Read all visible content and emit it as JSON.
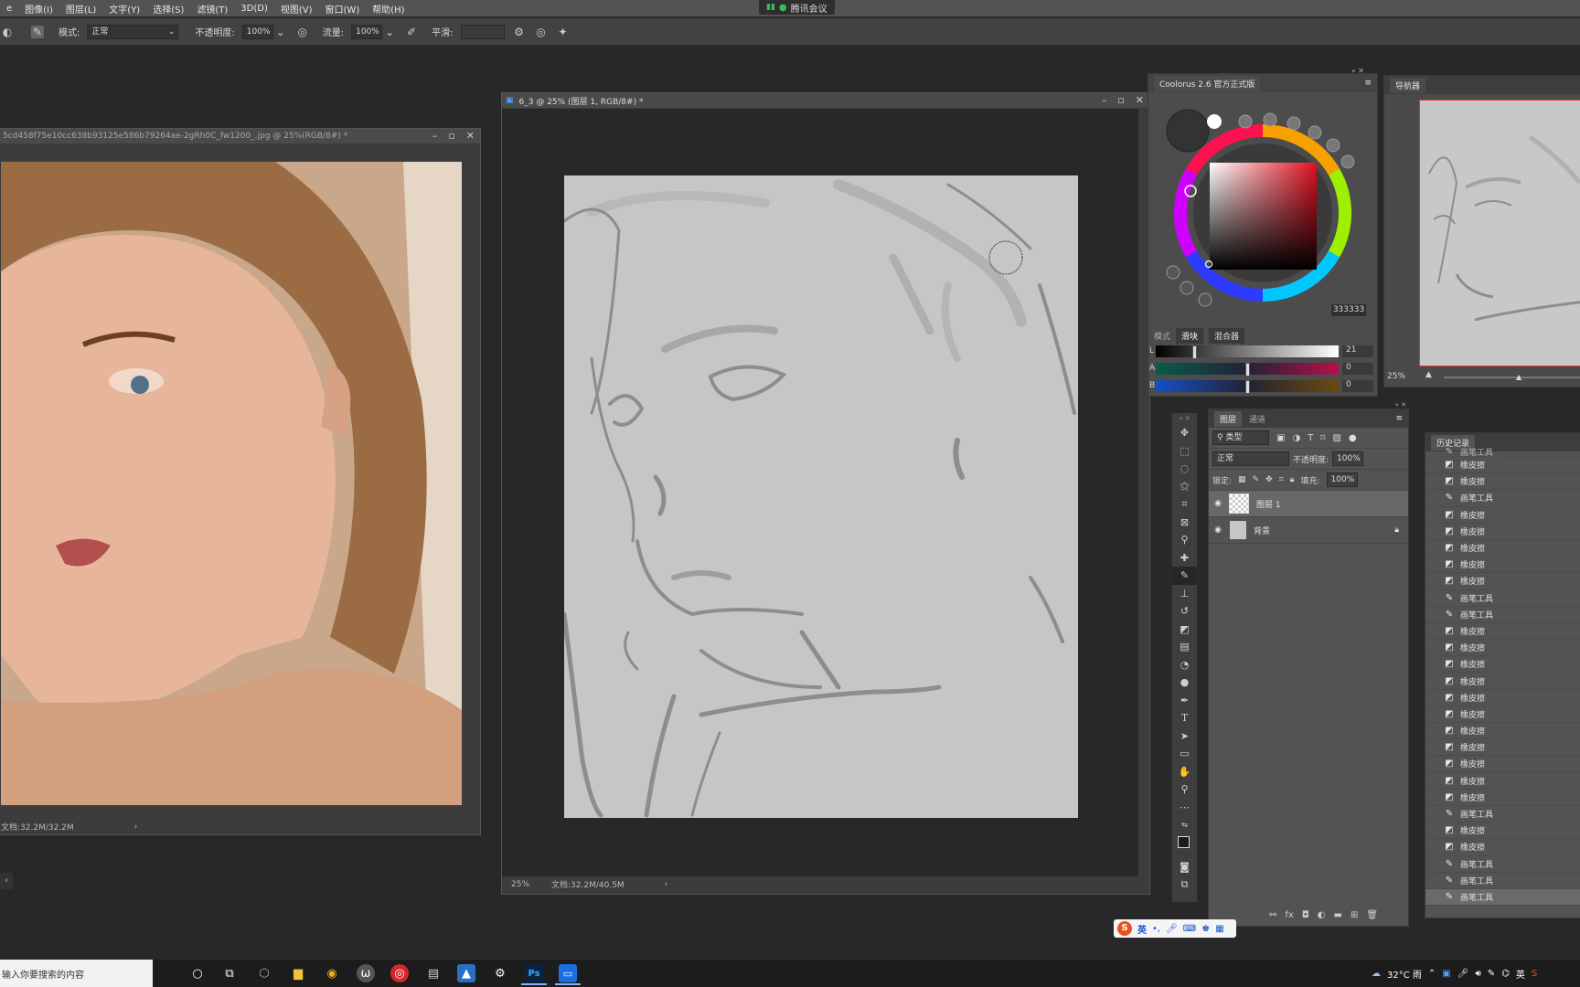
{
  "menubar": {
    "items": [
      "e",
      "图像(I)",
      "图层(L)",
      "文字(Y)",
      "选择(S)",
      "滤镜(T)",
      "3D(D)",
      "视图(V)",
      "窗口(W)",
      "帮助(H)"
    ],
    "meeting": "腾讯会议"
  },
  "options": {
    "mode_label": "模式:",
    "mode_value": "正常",
    "opacity_label": "不透明度:",
    "opacity_value": "100%",
    "flow_label": "流量:",
    "flow_value": "100%",
    "smooth_label": "平滑:"
  },
  "photo_window": {
    "title": "5cd458f75e10cc638b93125e586b79264ae-2gRh0C_fw1200_.jpg @ 25%(RGB/8#) *",
    "status": "文档:32.2M/32.2M"
  },
  "canvas_window": {
    "title": "6_3 @ 25% (图层 1, RGB/8#) *",
    "zoom": "25%",
    "status": "文档:32.2M/40.5M"
  },
  "coolorus": {
    "title": "Coolorus 2.6 官方正式版",
    "hex": "333333",
    "mode_label": "模式",
    "tab_slider": "滑块",
    "tab_mixer": "混合器",
    "L_label": "L",
    "A_label": "A",
    "B_label": "B",
    "L_value": "21",
    "A_value": "0",
    "B_value": "0"
  },
  "navigator": {
    "title": "导航器",
    "zoom": "25%"
  },
  "layers": {
    "tab_layers": "图层",
    "tab_channels": "通道",
    "filter_kind": "类型",
    "blend_mode": "正常",
    "opacity_label": "不透明度:",
    "opacity_value": "100%",
    "lock_label": "锁定:",
    "fill_label": "填充:",
    "fill_value": "100%",
    "rows": [
      {
        "name": "图层 1"
      },
      {
        "name": "背景"
      }
    ]
  },
  "history": {
    "title": "历史记录",
    "items": [
      {
        "icon": "eraser-icon",
        "label": "橡皮擦"
      },
      {
        "icon": "eraser-icon",
        "label": "橡皮擦"
      },
      {
        "icon": "brush-icon",
        "label": "画笔工具"
      },
      {
        "icon": "eraser-icon",
        "label": "橡皮擦"
      },
      {
        "icon": "eraser-icon",
        "label": "橡皮擦"
      },
      {
        "icon": "eraser-icon",
        "label": "橡皮擦"
      },
      {
        "icon": "eraser-icon",
        "label": "橡皮擦"
      },
      {
        "icon": "eraser-icon",
        "label": "橡皮擦"
      },
      {
        "icon": "brush-icon",
        "label": "画笔工具"
      },
      {
        "icon": "brush-icon",
        "label": "画笔工具"
      },
      {
        "icon": "eraser-icon",
        "label": "橡皮擦"
      },
      {
        "icon": "eraser-icon",
        "label": "橡皮擦"
      },
      {
        "icon": "eraser-icon",
        "label": "橡皮擦"
      },
      {
        "icon": "eraser-icon",
        "label": "橡皮擦"
      },
      {
        "icon": "eraser-icon",
        "label": "橡皮擦"
      },
      {
        "icon": "eraser-icon",
        "label": "橡皮擦"
      },
      {
        "icon": "eraser-icon",
        "label": "橡皮擦"
      },
      {
        "icon": "eraser-icon",
        "label": "橡皮擦"
      },
      {
        "icon": "eraser-icon",
        "label": "橡皮擦"
      },
      {
        "icon": "eraser-icon",
        "label": "橡皮擦"
      },
      {
        "icon": "eraser-icon",
        "label": "橡皮擦"
      },
      {
        "icon": "brush-icon",
        "label": "画笔工具"
      },
      {
        "icon": "eraser-icon",
        "label": "橡皮擦"
      },
      {
        "icon": "eraser-icon",
        "label": "橡皮擦"
      },
      {
        "icon": "brush-icon",
        "label": "画笔工具"
      },
      {
        "icon": "brush-icon",
        "label": "画笔工具"
      },
      {
        "icon": "brush-icon",
        "label": "画笔工具"
      }
    ]
  },
  "ime": {
    "label": "英"
  },
  "taskbar": {
    "search_placeholder": "输入你要搜索的内容",
    "weather": "32°C 雨",
    "lang": "英"
  }
}
